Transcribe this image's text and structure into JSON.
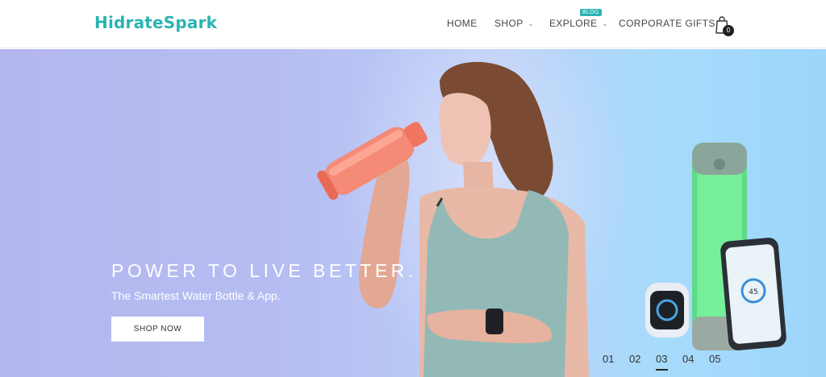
{
  "brand": {
    "logo_text": "HidrateSpark",
    "accent": "#2bb3b3"
  },
  "nav": {
    "items": [
      {
        "label": "HOME"
      },
      {
        "label": "SHOP",
        "has_dropdown": true
      },
      {
        "label": "EXPLORE",
        "has_dropdown": true,
        "badge": "BLOG"
      },
      {
        "label": "CORPORATE GIFTS"
      }
    ],
    "cart_count": "0",
    "cart_icon": "shopping-bag-icon"
  },
  "hero": {
    "title": "POWER TO LIVE BETTER.",
    "subtitle": "The Smartest Water Bottle & App.",
    "cta_label": "SHOP NOW",
    "slides": [
      "01",
      "02",
      "03",
      "04",
      "05"
    ],
    "active_slide": "03"
  },
  "phone": {
    "reading": "45"
  }
}
